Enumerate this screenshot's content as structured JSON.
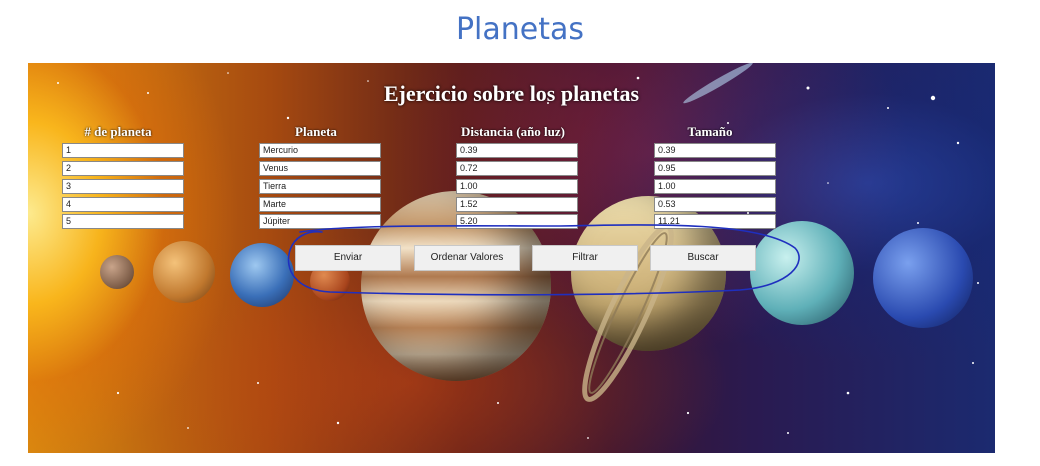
{
  "slide_title": "Planetas",
  "app": {
    "title": "Ejercicio sobre los planetas",
    "headers": [
      "# de planeta",
      "Planeta",
      "Distancia (año luz)",
      "Tamaño"
    ],
    "rows": [
      {
        "num": "1",
        "name": "Mercurio",
        "dist": "0.39",
        "size": "0.39"
      },
      {
        "num": "2",
        "name": "Venus",
        "dist": "0.72",
        "size": "0.95"
      },
      {
        "num": "3",
        "name": "Tierra",
        "dist": "1.00",
        "size": "1.00"
      },
      {
        "num": "4",
        "name": "Marte",
        "dist": "1.52",
        "size": "0.53"
      },
      {
        "num": "5",
        "name": "Júpiter",
        "dist": "5.20",
        "size": "11.21"
      }
    ],
    "buttons": {
      "enviar": "Enviar",
      "ordenar": "Ordenar Valores",
      "filtrar": "Filtrar",
      "buscar": "Buscar"
    }
  },
  "colors": {
    "slide_title": "#4472c4",
    "annotation": "#1f2fbf"
  }
}
